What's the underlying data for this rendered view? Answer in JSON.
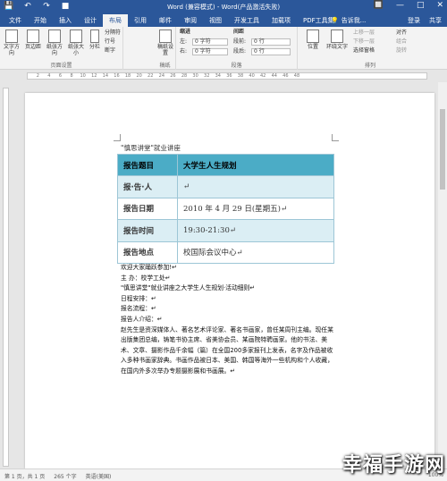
{
  "window": {
    "title": "Word (兼容模式) - Word(产品激活失败)",
    "quick_access": [
      "💾",
      "↶",
      "↷",
      "■"
    ],
    "controls": [
      "🔲",
      "—",
      "□",
      "✕"
    ]
  },
  "tabs": [
    {
      "label": "文件"
    },
    {
      "label": "开始"
    },
    {
      "label": "插入"
    },
    {
      "label": "设计"
    },
    {
      "label": "布局"
    },
    {
      "label": "引用"
    },
    {
      "label": "邮件"
    },
    {
      "label": "审阅"
    },
    {
      "label": "视图"
    },
    {
      "label": "开发工具"
    },
    {
      "label": "加载项"
    },
    {
      "label": "PDF工具集"
    }
  ],
  "active_tab": "布局",
  "tell_me": "告诉我...",
  "account": {
    "signin": "登录",
    "share": "共享"
  },
  "ribbon": {
    "page_setup": {
      "label": "页面设置",
      "text_direction": "文字方向",
      "margins": "页边距",
      "orientation": "纸张方向",
      "size": "纸张大小",
      "columns": "分栏",
      "breaks": "分隔符",
      "line_numbers": "行号",
      "hyphenation": "断字"
    },
    "manuscript": {
      "label": "稿纸",
      "btn": "稿纸设置"
    },
    "paragraph": {
      "label": "段落",
      "indent": "缩进",
      "spacing": "间距",
      "left_label": "左:",
      "left_val": "0 字符",
      "right_label": "右:",
      "right_val": "0 字符",
      "before_label": "段前:",
      "before_val": "0 行",
      "after_label": "段后:",
      "after_val": "0 行"
    },
    "arrange": {
      "label": "排列",
      "position": "位置",
      "wrap_text": "环绕文字",
      "bring_forward": "上移一层",
      "send_backward": "下移一层",
      "selection_pane": "选择窗格",
      "align": "对齐",
      "group": "组合",
      "rotate": "旋转"
    }
  },
  "ruler_numbers": [
    "2",
    "4",
    "6",
    "8",
    "10",
    "12",
    "14",
    "16",
    "18",
    "20",
    "22",
    "24",
    "26",
    "28",
    "30",
    "32",
    "34",
    "36",
    "38",
    "40",
    "42",
    "44",
    "46",
    "48"
  ],
  "document": {
    "heading": "\"慎思讲堂\"就业讲座",
    "table": [
      {
        "key": "报告题目",
        "value": "大学生人生规划"
      },
      {
        "key": "报·告·人",
        "value": "↵"
      },
      {
        "key": "报告日期",
        "value": "2010 年 4 月 29 日(星期五)↵"
      },
      {
        "key": "报告时间",
        "value": "19:30-21:30↵"
      },
      {
        "key": "报告地点",
        "value": "校国际会议中心↵"
      }
    ],
    "lines": [
      "欢迎大家踊跃参加!↵",
      "主 办：校学工处↵",
      "\"慎思讲堂\"就业讲座之大学生人生规划·活动细则↵",
      "日程安排：↵",
      "报名流程：↵",
      "报告人介绍：↵"
    ],
    "paragraph": "赵先生是资深媒体人、著名艺术评论家、著名书画家，曾任某周刊主编。现任某出版集团总编，铸笔书协主席、省美协会员、某画院特聘画家。他的书法、美术、文章、摄影作品千余幅（篇）在全国200多家报刊上发表，名字及作品被收入多种书画家辞典。书画作品被日本、美国、韩国等海外一些机构和个人收藏，在国内外多次举办专题摄影展和书画展。↵"
  },
  "status": {
    "page": "第 1 页，共 1 页",
    "words": "265 个字",
    "language": "英语(美国)",
    "zoom": "100%"
  },
  "watermark": "幸福手游网"
}
